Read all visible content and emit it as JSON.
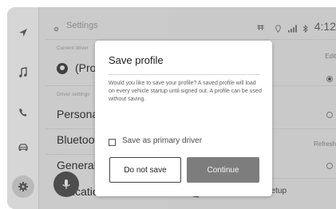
{
  "header": {
    "title": "Settings",
    "time": "4:12",
    "status_icons": [
      "gear-icon",
      "bluetooth-phone-icon",
      "location-pin-icon",
      "signal-icon",
      "bluetooth-icon"
    ]
  },
  "nav": {
    "items": [
      {
        "icon": "navigation-arrow-icon"
      },
      {
        "icon": "music-note-icon"
      },
      {
        "icon": "phone-icon"
      },
      {
        "icon": "car-icon"
      },
      {
        "icon": "gear-icon"
      }
    ]
  },
  "left_panel": {
    "current_driver_caption": "Current driver",
    "current_driver_value": "(Pro",
    "driver_settings_caption": "Driver settings",
    "rows": [
      "Personal",
      "Bluetooth",
      "General"
    ],
    "bottom_row": "ications"
  },
  "right_panel": {
    "edit_label": "Edit",
    "refresh_label": "Refresh",
    "manual_setup_label": "Manual setup"
  },
  "dialog": {
    "title": "Save profile",
    "body": "Would you like to save your profile? A saved profile will load on every vehicle startup until signed out. A profile can be used without saving.",
    "checkbox_label": "Save as primary driver",
    "checkbox_checked": false,
    "secondary_button": "Do not save",
    "primary_button": "Continue"
  },
  "colors": {
    "overlay": "#cfcfcf",
    "dialog_bg": "#ffffff",
    "primary_button": "#7d7d7d",
    "voice_button": "#4d4d4d"
  }
}
